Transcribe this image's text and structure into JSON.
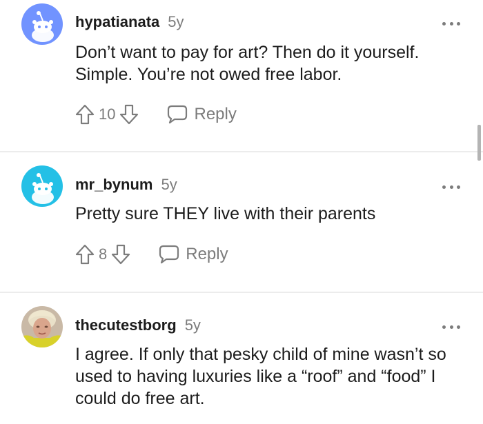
{
  "comments": [
    {
      "username": "hypatianata",
      "age": "5y",
      "text": "Don’t want to pay for art? Then do it yourself. Simple. You’re not owed free labor.",
      "score": "10",
      "reply_label": "Reply",
      "avatar": {
        "type": "snoo",
        "bg": "#7193ff",
        "icon": "snoo-avatar-icon"
      }
    },
    {
      "username": "mr_bynum",
      "age": "5y",
      "text": "Pretty sure THEY live with their parents",
      "score": "8",
      "reply_label": "Reply",
      "avatar": {
        "type": "snoo",
        "bg": "#24c0e6",
        "icon": "snoo-avatar-icon"
      }
    },
    {
      "username": "thecutestborg",
      "age": "5y",
      "text": "I agree. If only that pesky child of mine wasn’t so used to having luxuries like a “roof” and “food” I could do free art.",
      "avatar": {
        "type": "photo",
        "icon": "user-photo-avatar"
      }
    }
  ],
  "colors": {
    "text": "#1c1c1c",
    "meta": "#7c7c7c",
    "divider": "#ececec"
  }
}
